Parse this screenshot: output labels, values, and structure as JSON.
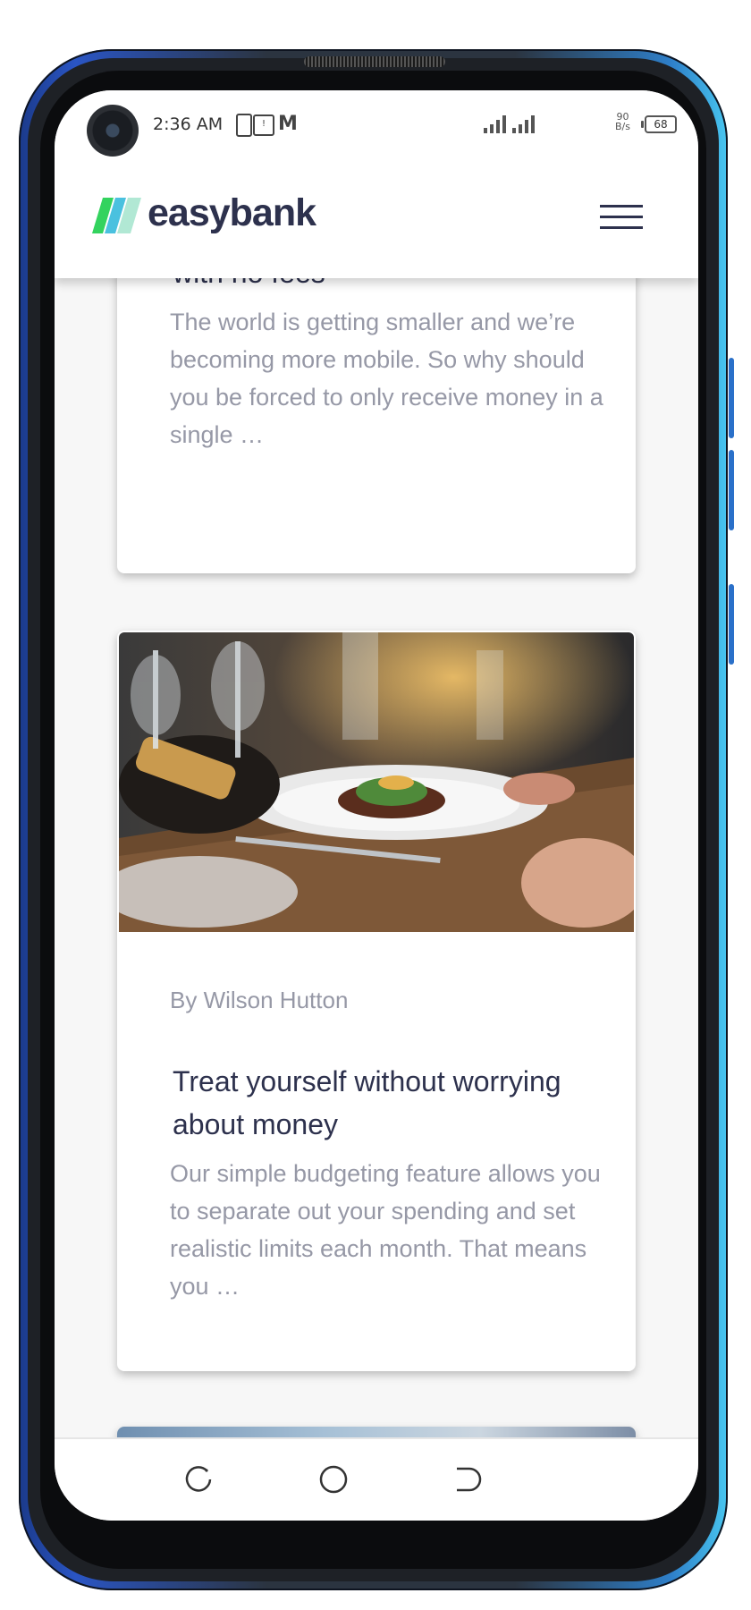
{
  "status_bar": {
    "time": "2:36 AM",
    "net_speed_value": "90",
    "net_speed_unit": "B/s",
    "battery": "68",
    "icons": [
      "battery-charging-icon",
      "sim-card-icon",
      "gmail-icon",
      "signal-4g-icon",
      "signal-icon"
    ]
  },
  "header": {
    "logo_text": "easybank",
    "logo_colors": [
      "#33d35e",
      "#2ab6d9",
      "#a8e6cf"
    ],
    "menu_icon": "hamburger-menu-icon"
  },
  "articles": [
    {
      "title": "Receive money in any currency with no fees",
      "excerpt": "The world is getting smaller and we’re becoming more mobile. So why should you be forced to only receive money in a single …"
    },
    {
      "author": "By Wilson Hutton",
      "title": "Treat yourself without worrying about money",
      "excerpt": "Our simple budgeting feature allows you to separate out your spending and set realistic limits each month. That means you …",
      "image": "restaurant-dinner-table-photo"
    },
    {
      "image": "partial-article-image"
    }
  ],
  "nav_bar": {
    "buttons": [
      "recent-apps-icon",
      "home-icon",
      "back-icon"
    ]
  },
  "colors": {
    "dark_blue": "#2d314d",
    "grayish_blue": "#9698a6",
    "background": "#f7f7f7"
  }
}
